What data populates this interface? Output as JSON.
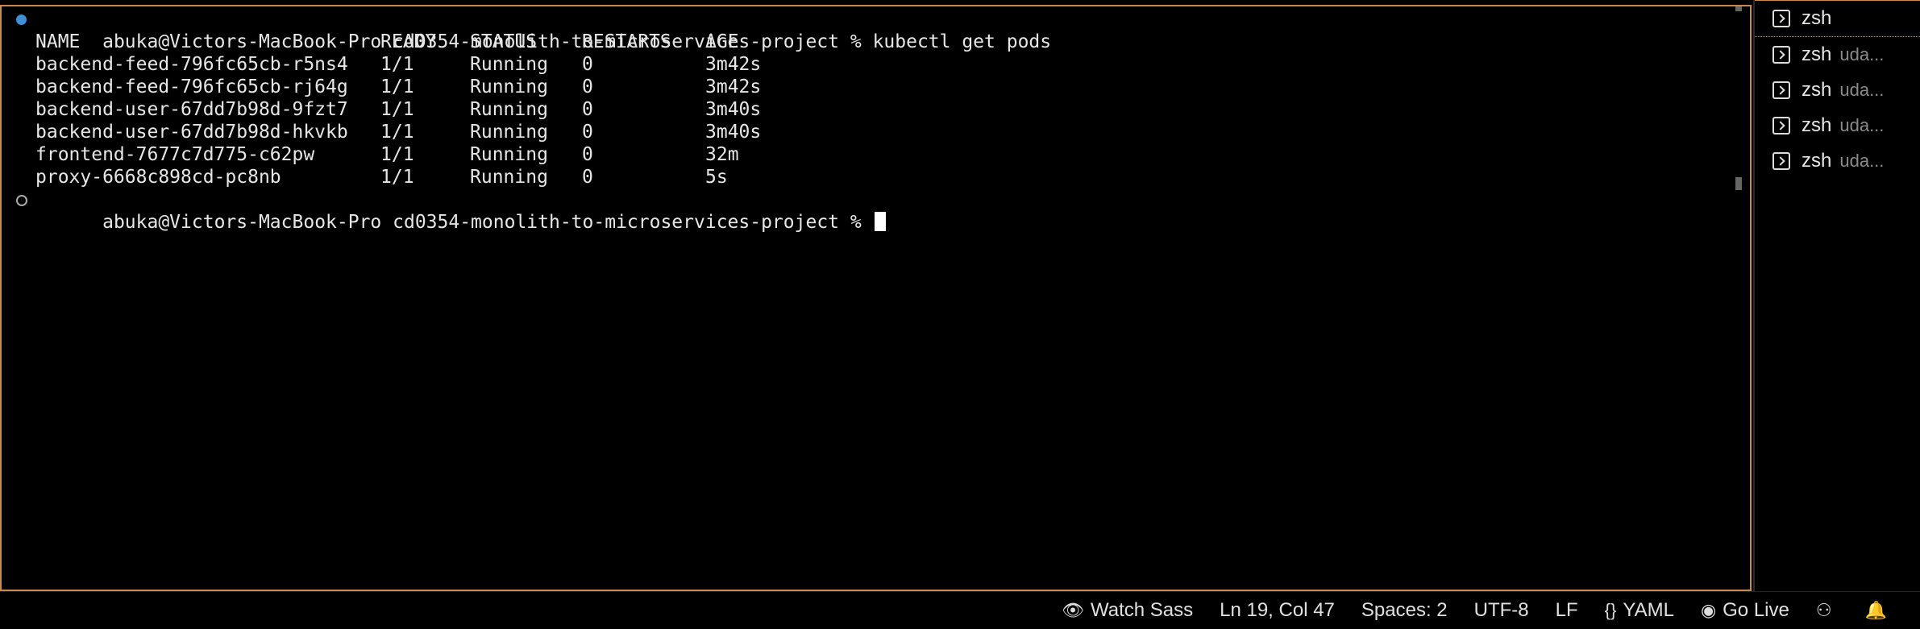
{
  "terminal": {
    "prompt": "abuka@Victors-MacBook-Pro cd0354-monolith-to-microservices-project %",
    "command": "kubectl get pods",
    "columns": [
      "NAME",
      "READY",
      "STATUS",
      "RESTARTS",
      "AGE"
    ],
    "rows": [
      [
        "backend-feed-796fc65cb-r5ns4",
        "1/1",
        "Running",
        "0",
        "3m42s"
      ],
      [
        "backend-feed-796fc65cb-rj64g",
        "1/1",
        "Running",
        "0",
        "3m42s"
      ],
      [
        "backend-user-67dd7b98d-9fzt7",
        "1/1",
        "Running",
        "0",
        "3m40s"
      ],
      [
        "backend-user-67dd7b98d-hkvkb",
        "1/1",
        "Running",
        "0",
        "3m40s"
      ],
      [
        "frontend-7677c7d775-c62pw",
        "1/1",
        "Running",
        "0",
        "32m"
      ],
      [
        "proxy-6668c898cd-pc8nb",
        "1/1",
        "Running",
        "0",
        "5s"
      ]
    ],
    "prompt2": "abuka@Victors-MacBook-Pro cd0354-monolith-to-microservices-project %"
  },
  "tabs": [
    {
      "label": "zsh",
      "desc": ""
    },
    {
      "label": "zsh",
      "desc": "uda..."
    },
    {
      "label": "zsh",
      "desc": "uda..."
    },
    {
      "label": "zsh",
      "desc": "uda..."
    },
    {
      "label": "zsh",
      "desc": "uda..."
    }
  ],
  "statusbar": {
    "watch_sass": "Watch Sass",
    "position": "Ln 19, Col 47",
    "spaces": "Spaces: 2",
    "encoding": "UTF-8",
    "eol": "LF",
    "language": "YAML",
    "go_live": "Go Live"
  },
  "colors": {
    "accent": "#c98a4b",
    "dot": "#3d8fd6"
  }
}
